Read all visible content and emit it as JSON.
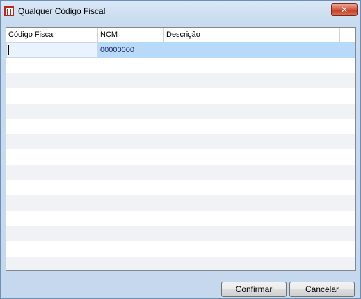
{
  "window": {
    "title": "Qualquer Código Fiscal",
    "close_label": "✕"
  },
  "grid": {
    "columns": [
      "Código Fiscal",
      "NCM",
      "Descrição",
      ""
    ],
    "rows": [
      {
        "codigo_fiscal": "",
        "ncm": "00000000",
        "descricao": "",
        "selected": true
      }
    ]
  },
  "buttons": {
    "confirm_label": "Confirmar",
    "cancel_label": "Cancelar"
  },
  "colors": {
    "selected_row": "#b9d9f8",
    "alt_row": "#f0f2f6",
    "close_button": "#c23b1f"
  },
  "icons": {
    "app": "app-logo-icon",
    "close": "close-icon"
  }
}
